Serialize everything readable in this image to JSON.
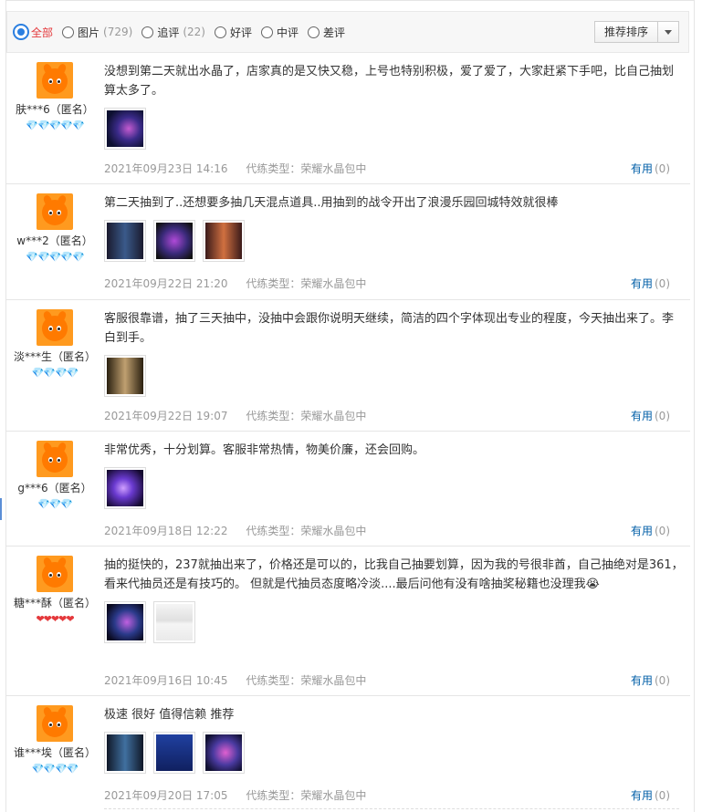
{
  "filters": {
    "items": [
      {
        "label": "全部",
        "count": "",
        "selected": true
      },
      {
        "label": "图片",
        "count": "(729)"
      },
      {
        "label": "追评",
        "count": "(22)"
      },
      {
        "label": "好评",
        "count": ""
      },
      {
        "label": "中评",
        "count": ""
      },
      {
        "label": "差评",
        "count": ""
      }
    ],
    "sort_label": "推荐排序"
  },
  "reviews": [
    {
      "user": "肤***6（匿名）",
      "level": "💎💎💎💎💎",
      "text": "没想到第二天就出水晶了，店家真的是又快又稳，上号也特别积极，爱了爱了，大家赶紧下手吧，比自己抽划算太多了。",
      "date": "2021年09月23日 14:16",
      "type": "代练类型：荣耀水晶包中",
      "useful": "有用",
      "useful_count": "(0)"
    },
    {
      "user": "w***2（匿名）",
      "level": "💎💎💎💎💎",
      "text": "第二天抽到了..还想要多抽几天混点道具..用抽到的战令开出了浪漫乐园回城特效就很棒",
      "date": "2021年09月22日 21:20",
      "type": "代练类型：荣耀水晶包中",
      "useful": "有用",
      "useful_count": "(0)"
    },
    {
      "user": "淡***生（匿名）",
      "level": "💎💎💎💎",
      "text": "客服很靠谱，抽了三天抽中，没抽中会跟你说明天继续，简洁的四个字体现出专业的程度，今天抽出来了。李白到手。",
      "date": "2021年09月22日 19:07",
      "type": "代练类型：荣耀水晶包中",
      "useful": "有用",
      "useful_count": "(0)"
    },
    {
      "user": "g***6（匿名）",
      "level": "💎💎💎",
      "text": "非常优秀，十分划算。客服非常热情，物美价廉，还会回购。",
      "date": "2021年09月18日 12:22",
      "type": "代练类型：荣耀水晶包中",
      "useful": "有用",
      "useful_count": "(0)"
    },
    {
      "user": "糖***酥（匿名）",
      "level": "❤❤❤❤❤",
      "text": "抽的挺快的，237就抽出来了，价格还是可以的，比我自己抽要划算，因为我的号很非酋，自己抽绝对是361，看来代抽员还是有技巧的。 但就是代抽员态度略冷淡....最后问他有没有啥抽奖秘籍也没理我😭",
      "date": "2021年09月16日 10:45",
      "type": "代练类型：荣耀水晶包中",
      "useful": "有用",
      "useful_count": "(0)"
    },
    {
      "user": "谁***埃（匿名）",
      "level": "💎💎💎💎",
      "text": "极速 很好 值得信赖 推荐",
      "date": "2021年09月20日 17:05",
      "type": "代练类型：荣耀水晶包中",
      "useful": "有用",
      "useful_count": "(0)"
    }
  ],
  "colors": {
    "accent_red": "#e4393c",
    "link_blue": "#005ea7",
    "radio_blue": "#2b7fe0"
  }
}
